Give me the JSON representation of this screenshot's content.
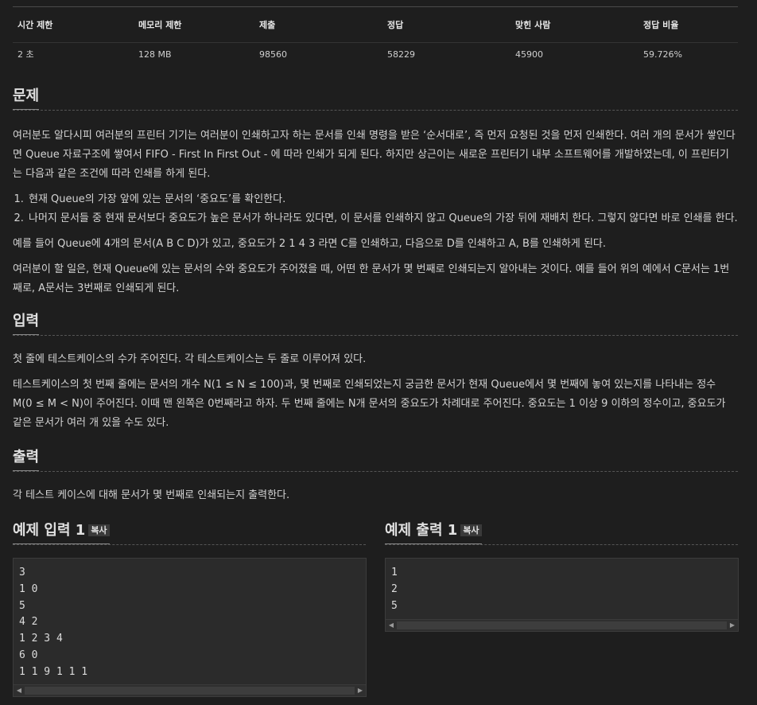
{
  "stats": {
    "headers": [
      "시간 제한",
      "메모리 제한",
      "제출",
      "정답",
      "맞힌 사람",
      "정답 비율"
    ],
    "values": [
      "2 초",
      "128 MB",
      "98560",
      "58229",
      "45900",
      "59.726%"
    ]
  },
  "problem": {
    "title": "문제",
    "p1": "여러분도 알다시피 여러분의 프린터 기기는 여러분이 인쇄하고자 하는 문서를 인쇄 명령을 받은 ‘순서대로’, 즉 먼저 요청된 것을 먼저 인쇄한다. 여러 개의 문서가 쌓인다면 Queue 자료구조에 쌓여서 FIFO - First In First Out - 에 따라 인쇄가 되게 된다. 하지만 상근이는 새로운 프린터기 내부 소프트웨어를 개발하였는데, 이 프린터기는 다음과 같은 조건에 따라 인쇄를 하게 된다.",
    "rules": [
      "현재 Queue의 가장 앞에 있는 문서의 ‘중요도’를 확인한다.",
      "나머지 문서들 중 현재 문서보다 중요도가 높은 문서가 하나라도 있다면, 이 문서를 인쇄하지 않고 Queue의 가장 뒤에 재배치 한다. 그렇지 않다면 바로 인쇄를 한다."
    ],
    "p2": "예를 들어 Queue에 4개의 문서(A B C D)가 있고, 중요도가 2 1 4 3 라면 C를 인쇄하고, 다음으로 D를 인쇄하고 A, B를 인쇄하게 된다.",
    "p3": "여러분이 할 일은, 현재 Queue에 있는 문서의 수와 중요도가 주어졌을 때, 어떤 한 문서가 몇 번째로 인쇄되는지 알아내는 것이다. 예를 들어 위의 예에서 C문서는 1번째로, A문서는 3번째로 인쇄되게 된다."
  },
  "input": {
    "title": "입력",
    "p1": "첫 줄에 테스트케이스의 수가 주어진다. 각 테스트케이스는 두 줄로 이루어져 있다.",
    "p2": "테스트케이스의 첫 번째 줄에는 문서의 개수 N(1 ≤ N ≤ 100)과, 몇 번째로 인쇄되었는지 궁금한 문서가 현재 Queue에서 몇 번째에 놓여 있는지를 나타내는 정수 M(0 ≤ M < N)이 주어진다. 이때 맨 왼쪽은 0번째라고 하자. 두 번째 줄에는 N개 문서의 중요도가 차례대로 주어진다. 중요도는 1 이상 9 이하의 정수이고, 중요도가 같은 문서가 여러 개 있을 수도 있다."
  },
  "output": {
    "title": "출력",
    "p1": "각 테스트 케이스에 대해 문서가 몇 번째로 인쇄되는지 출력한다."
  },
  "sample_input": {
    "title": "예제 입력 1",
    "copy_label": "복사",
    "content": "3\n1 0\n5\n4 2\n1 2 3 4\n6 0\n1 1 9 1 1 1"
  },
  "sample_output": {
    "title": "예제 출력 1",
    "copy_label": "복사",
    "content": "1\n2\n5"
  }
}
